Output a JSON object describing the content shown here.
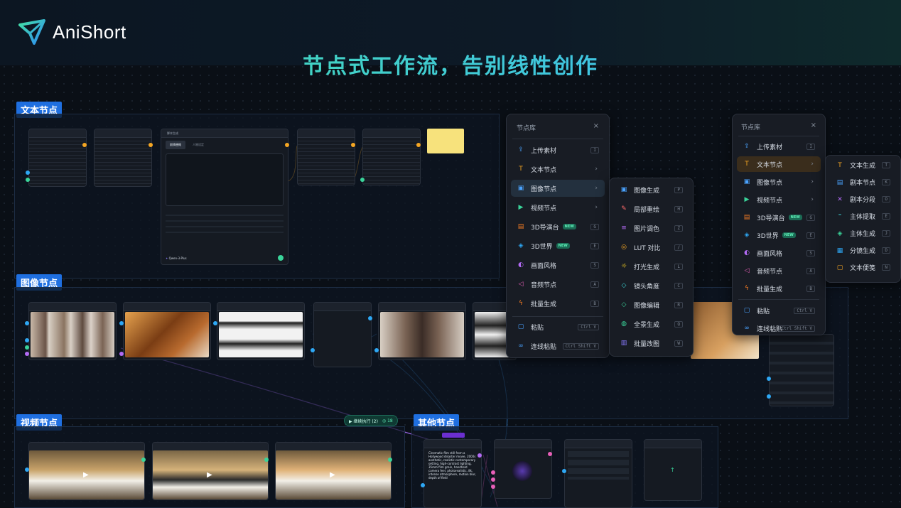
{
  "brand": {
    "name": "AniShort"
  },
  "headline": "节点式工作流，告别线性创作",
  "sections": {
    "text": "文本节点",
    "image": "图像节点",
    "video": "视频节点",
    "other": "其他节点"
  },
  "text_nodes": {
    "script_node_title": "脚本生成",
    "script_tab_1": "剧情梗概",
    "script_tab_2": "人物设定",
    "model_name": "Qwen-3-Plus"
  },
  "exec_pill": {
    "label": "▶ 继续执行 (2)",
    "count": "18"
  },
  "other_nodes": {
    "prompt_text": "Cinematic film still from a Hollywood disaster movie, 2000s aesthetic, realistic contemporary setting, high-contrast lighting, 35mm film grain, handheld camera feel, photorealistic, 8k, intense atmosphere, motion blur, depth of field"
  },
  "menu_main": {
    "title": "节点库",
    "close": "×",
    "items": [
      {
        "label": "上传素材",
        "key": "I",
        "icon": "upload-icon",
        "color": "#4aa3ff"
      },
      {
        "label": "文本节点",
        "chev": "›",
        "icon": "text-icon",
        "color": "#f5a623"
      },
      {
        "label": "图像节点",
        "chev": "›",
        "icon": "image-icon",
        "color": "#4aa3ff"
      },
      {
        "label": "视频节点",
        "chev": "›",
        "icon": "video-icon",
        "color": "#3ad49a"
      },
      {
        "label": "3D导演台",
        "badge": "NEW",
        "key": "G",
        "icon": "clapper-icon",
        "color": "#f57c23"
      },
      {
        "label": "3D世界",
        "badge": "NEW",
        "key": "E",
        "icon": "cube-icon",
        "color": "#2ea8f5"
      },
      {
        "label": "画面风格",
        "key": "S",
        "icon": "palette-icon",
        "color": "#b36bf5"
      },
      {
        "label": "音频节点",
        "key": "A",
        "icon": "audio-icon",
        "color": "#e85fb8"
      },
      {
        "label": "批量生成",
        "key": "B",
        "icon": "bolt-icon",
        "color": "#f57c23"
      },
      {
        "label": "粘贴",
        "key": "Ctrl V",
        "icon": "paste-icon",
        "color": "#4aa3ff"
      },
      {
        "label": "连线粘贴",
        "key": "Ctrl Shift V",
        "icon": "link-icon",
        "color": "#4aa3ff"
      }
    ]
  },
  "menu_image_sub": {
    "items": [
      {
        "label": "图像生成",
        "key": "P",
        "icon": "image-gen-icon",
        "color": "#4aa3ff"
      },
      {
        "label": "局部重绘",
        "key": "H",
        "icon": "brush-icon",
        "color": "#ff6b6b"
      },
      {
        "label": "图片调色",
        "key": "Z",
        "icon": "sliders-icon",
        "color": "#b36bf5"
      },
      {
        "label": "LUT 对比",
        "key": "/",
        "icon": "layers-icon",
        "color": "#f5a623"
      },
      {
        "label": "打光生成",
        "key": "L",
        "icon": "sun-icon",
        "color": "#f5d023"
      },
      {
        "label": "镜头角度",
        "key": "C",
        "icon": "camera-angle-icon",
        "color": "#3ad4d4"
      },
      {
        "label": "图像编辑",
        "key": "R",
        "icon": "eraser-icon",
        "color": "#3ad49a"
      },
      {
        "label": "全景生成",
        "key": "Q",
        "icon": "globe-icon",
        "color": "#3ad49a"
      },
      {
        "label": "批量改图",
        "key": "W",
        "icon": "stack-icon",
        "color": "#8a7bff"
      }
    ]
  },
  "menu_right": {
    "title": "节点库",
    "close": "×",
    "items": [
      {
        "label": "上传素材",
        "key": "I",
        "icon": "upload-icon",
        "color": "#4aa3ff"
      },
      {
        "label": "文本节点",
        "chev": "›",
        "icon": "text-icon",
        "color": "#f5a623"
      },
      {
        "label": "图像节点",
        "chev": "›",
        "icon": "image-icon",
        "color": "#4aa3ff"
      },
      {
        "label": "视频节点",
        "chev": "›",
        "icon": "video-icon",
        "color": "#3ad49a"
      },
      {
        "label": "3D导演台",
        "badge": "NEW",
        "key": "G",
        "icon": "clapper-icon",
        "color": "#f57c23"
      },
      {
        "label": "3D世界",
        "badge": "NEW",
        "key": "E",
        "icon": "cube-icon",
        "color": "#2ea8f5"
      },
      {
        "label": "画面风格",
        "key": "S",
        "icon": "palette-icon",
        "color": "#b36bf5"
      },
      {
        "label": "音频节点",
        "key": "A",
        "icon": "audio-icon",
        "color": "#e85fb8"
      },
      {
        "label": "批量生成",
        "key": "B",
        "icon": "bolt-icon",
        "color": "#f57c23"
      },
      {
        "label": "粘贴",
        "key": "Ctrl V",
        "icon": "paste-icon",
        "color": "#4aa3ff"
      },
      {
        "label": "连线粘贴",
        "key": "Ctrl Shift V",
        "icon": "link-icon",
        "color": "#4aa3ff"
      }
    ]
  },
  "menu_text_sub": {
    "items": [
      {
        "label": "文本生成",
        "key": "T",
        "icon": "text-gen-icon",
        "color": "#f5a623"
      },
      {
        "label": "剧本节点",
        "key": "K",
        "icon": "script-icon",
        "color": "#4aa3ff"
      },
      {
        "label": "剧本分段",
        "key": "O",
        "icon": "split-icon",
        "color": "#b36bf5"
      },
      {
        "label": "主体提取",
        "key": "E",
        "icon": "extract-icon",
        "color": "#3ad4d4"
      },
      {
        "label": "主体生成",
        "key": "J",
        "icon": "subject-icon",
        "color": "#3ad49a"
      },
      {
        "label": "分镜生成",
        "key": "D",
        "icon": "storyboard-icon",
        "color": "#2ea8f5"
      },
      {
        "label": "文本便笺",
        "key": "N",
        "icon": "note-icon",
        "color": "#f5a623"
      }
    ]
  }
}
